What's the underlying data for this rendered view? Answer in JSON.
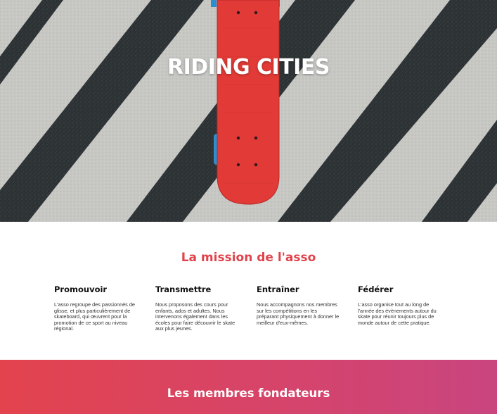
{
  "hero": {
    "title": "RIDING CITIES"
  },
  "mission": {
    "title": "La mission de l'asso",
    "columns": [
      {
        "heading": "Promouvoir",
        "text": "L'asso regroupe des passionnés de glisse, et plus particulièrement de skateboard, qui œuvrent pour la promotion de ce sport au niveau régional."
      },
      {
        "heading": "Transmettre",
        "text": "Nous proposons des cours pour enfants, ados et adultes. Nous intervenons également dans les écoles pour faire découvrir le skate aux plus jeunes."
      },
      {
        "heading": "Entraîner",
        "text": "Nous accompagnons nos membres sur les compétitions en les préparant physiquement à donner le meilleur d'eux-mêmes."
      },
      {
        "heading": "Fédérer",
        "text": "L'asso organise tout au long de l'année des évènements autour du skate pour réunir toujours plus de monde autour de cette pratique."
      }
    ]
  },
  "founders": {
    "title": "Les membres fondateurs"
  },
  "colors": {
    "accent": "#e0434b",
    "gradient_start": "#e3434d",
    "gradient_end": "#c9457f",
    "asphalt": "#2f3336",
    "stripe": "#c9c9c6",
    "board": "#e23a36",
    "wheels": "#2a8fd1"
  }
}
